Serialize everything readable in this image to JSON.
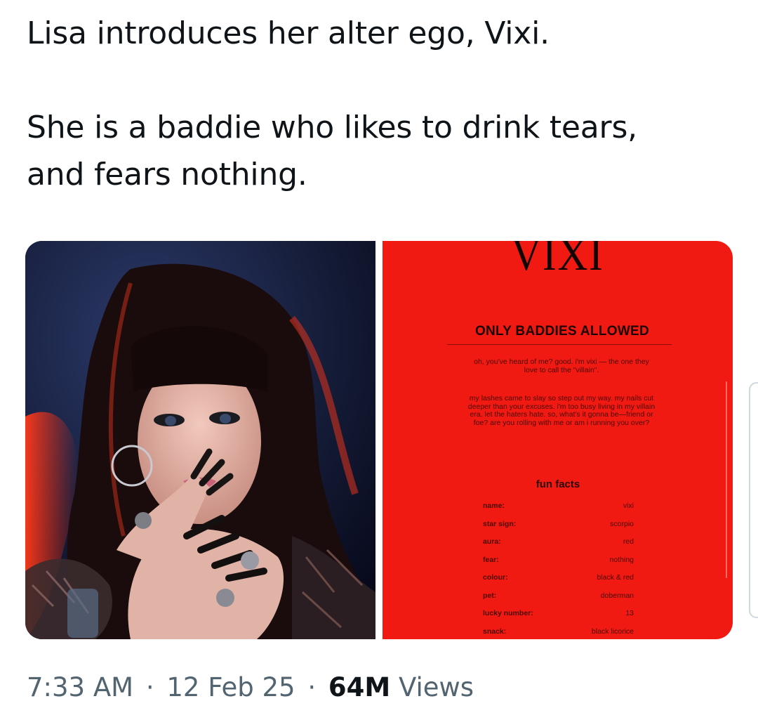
{
  "tweet": {
    "text_line1": "Lisa introduces her alter ego, Vixi.",
    "text_line2": "She is a baddie who likes to drink tears,",
    "text_line3": "and fears nothing."
  },
  "card": {
    "logo": "VIXI",
    "heading": "ONLY BADDIES ALLOWED",
    "para1": "oh, you've heard of me? good. i'm vixi — the one they love to call the \"villain\".",
    "para2": "my lashes came to slay so step out my way. my nails cut deeper than your excuses. i'm too busy living in my villain era. let the haters hate. so, what's it gonna be—friend or foe? are you rolling with me or am i running you over?",
    "fun_facts_title": "fun facts",
    "facts": [
      {
        "key": "name:",
        "value": "vixi"
      },
      {
        "key": "star sign:",
        "value": "scorpio"
      },
      {
        "key": "aura:",
        "value": "red"
      },
      {
        "key": "fear:",
        "value": "nothing"
      },
      {
        "key": "colour:",
        "value": "black & red"
      },
      {
        "key": "pet:",
        "value": "doberman"
      },
      {
        "key": "lucky number:",
        "value": "13"
      },
      {
        "key": "snack:",
        "value": "black licorice"
      }
    ]
  },
  "meta": {
    "time": "7:33 AM",
    "separator": "·",
    "date": "12 Feb 25",
    "views_count": "64M",
    "views_label": "Views"
  },
  "colors": {
    "card_red": "#f11a12",
    "meta_gray": "#536471",
    "text_dark": "#0f1419"
  }
}
